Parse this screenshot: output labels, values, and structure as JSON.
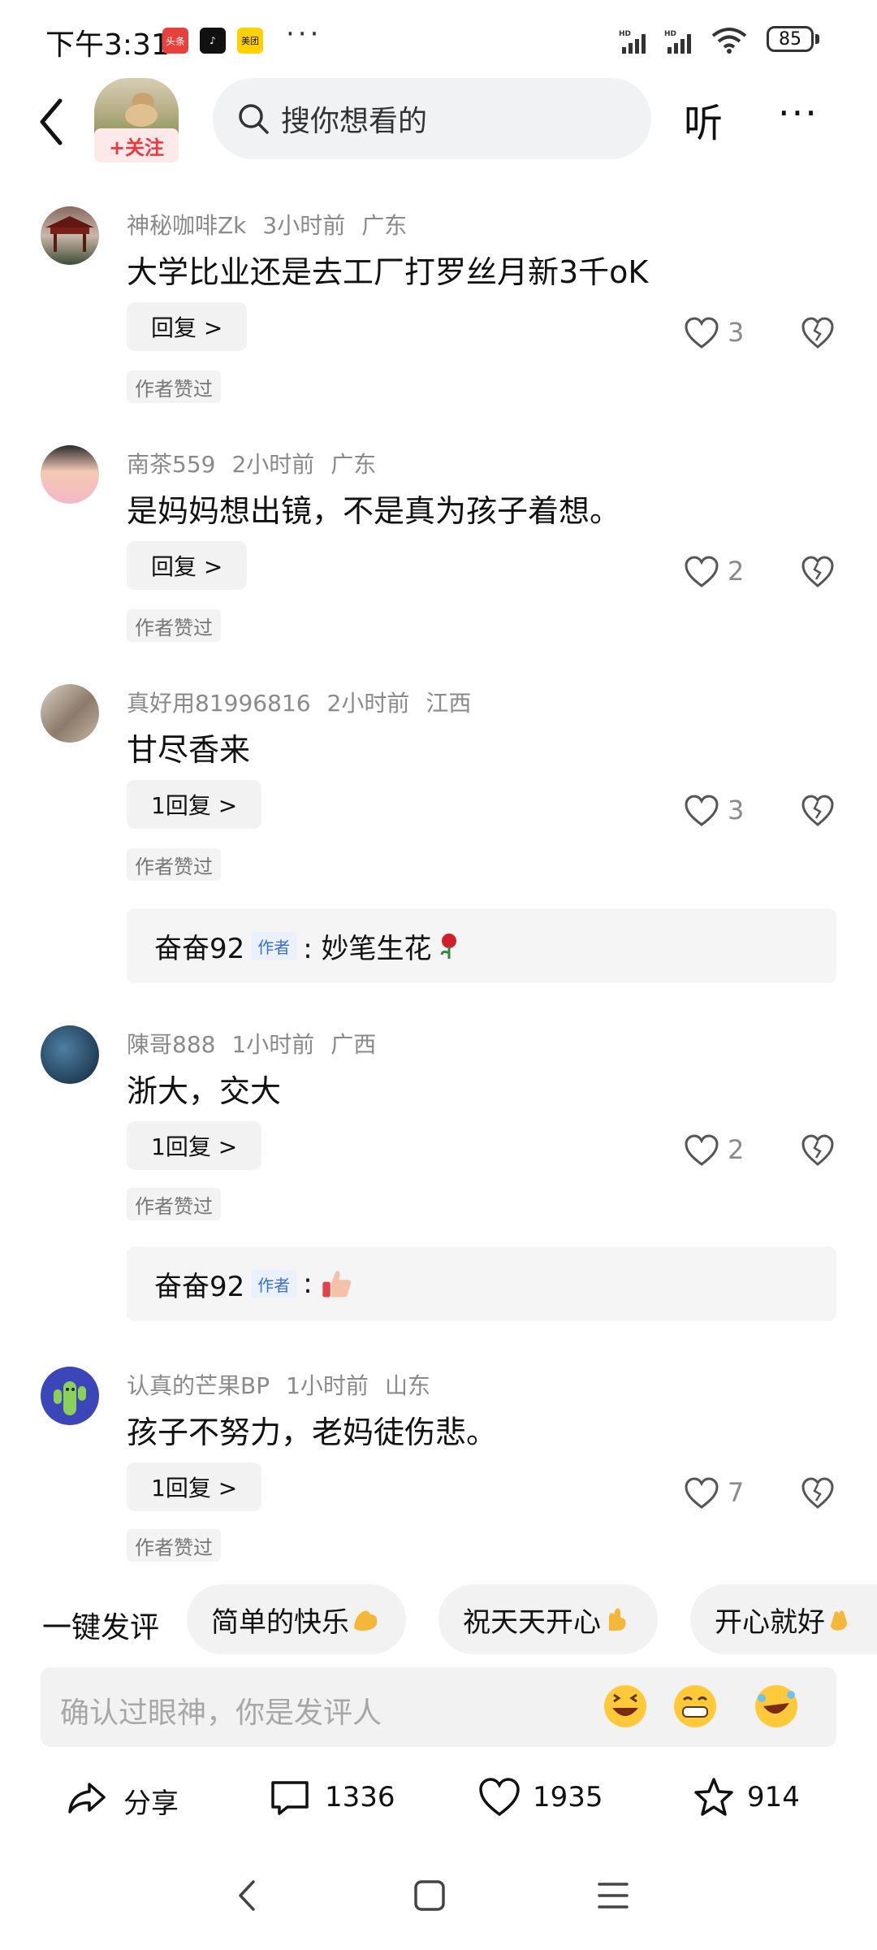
{
  "status_bar": {
    "time": "下午3:31",
    "apps": [
      "头条",
      "抖音",
      "美团"
    ],
    "more": "···",
    "battery": "85"
  },
  "header": {
    "follow_label": "+关注",
    "search_placeholder": "搜你想看的",
    "listen_label": "听",
    "more_label": "···"
  },
  "comments": [
    {
      "user": "神秘咖啡Zk",
      "time": "3小时前",
      "location": "广东",
      "text": "大学比业还是去工厂打罗丝月新3千oK",
      "reply_label": "回复 >",
      "likes": "3",
      "liked_by_author": "作者赞过"
    },
    {
      "user": "南茶559",
      "time": "2小时前",
      "location": "广东",
      "text": "是妈妈想出镜，不是真为孩子着想。",
      "reply_label": "回复 >",
      "likes": "2",
      "liked_by_author": "作者赞过"
    },
    {
      "user": "真好用81996816",
      "time": "2小时前",
      "location": "江西",
      "text": "甘尽香来",
      "reply_label": "1回复 >",
      "likes": "3",
      "liked_by_author": "作者赞过",
      "sub_reply": {
        "user": "奋奋92",
        "tag": "作者",
        "text": ": 妙笔生花"
      }
    },
    {
      "user": "陳哥888",
      "time": "1小时前",
      "location": "广西",
      "text": "浙大，交大",
      "reply_label": "1回复 >",
      "likes": "2",
      "liked_by_author": "作者赞过",
      "sub_reply": {
        "user": "奋奋92",
        "tag": "作者",
        "text": ":"
      }
    },
    {
      "user": "认真的芒果BP",
      "time": "1小时前",
      "location": "山东",
      "text": "孩子不努力，老妈徒伤悲。",
      "reply_label": "1回复 >",
      "likes": "7",
      "liked_by_author": "作者赞过"
    }
  ],
  "quick_comments": {
    "label": "一键发评",
    "chips": [
      "简单的快乐",
      "祝天天开心",
      "开心就好"
    ]
  },
  "input": {
    "placeholder": "确认过眼神，你是发评人"
  },
  "actions": {
    "share": "分享",
    "comments": "1336",
    "likes": "1935",
    "favorites": "914"
  },
  "colors": {
    "accent_red": "#f0353d",
    "author_blue": "#3b70c9"
  }
}
